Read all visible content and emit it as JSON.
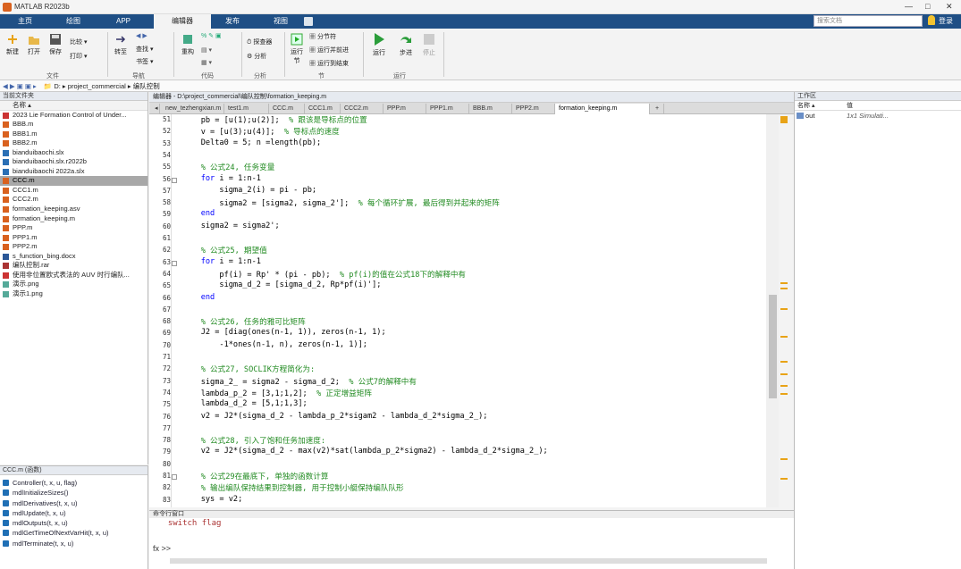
{
  "window": {
    "title": "MATLAB R2023b",
    "min": "—",
    "max": "□",
    "close": "✕"
  },
  "tabs": [
    "主页",
    "绘图",
    "APP",
    "编辑器",
    "发布",
    "视图"
  ],
  "active_tab": "编辑器",
  "search": {
    "placeholder": "搜索文档"
  },
  "user": "登录",
  "ribbon": {
    "new": "新建",
    "open": "打开",
    "save": "保存",
    "compare": "比较",
    "print": "打印",
    "file_group": "文件",
    "goto": "转至",
    "find": "查找",
    "bookmark": "书签",
    "navigate_group": "导航",
    "refactor": "重构",
    "code_group": "代码",
    "profiler": "探查器",
    "analyze": "分析",
    "analyze_group": "分析",
    "run_section": "运行节",
    "section_break": "分节符",
    "run_advance": "运行并前进",
    "run_to_end": "运行到结束",
    "section_group": "节",
    "run": "运行",
    "step": "步进",
    "stop": "停止",
    "run_group": "运行"
  },
  "address": {
    "drive": "D:",
    "folder1": "project_commercial",
    "folder2": "编队控制"
  },
  "file_panel": {
    "title": "当前文件夹",
    "col_name": "名称 ▴"
  },
  "files": [
    "2023 Lie Formation Control of Under...",
    "BBB.m",
    "BBB1.m",
    "BBB2.m",
    "bianduibaochi.slx",
    "bianduibaochi.slx.r2022b",
    "bianduibaochi 2022a.slx",
    "CCC.m",
    "CCC1.m",
    "CCC2.m",
    "formation_keeping.asv",
    "formation_keeping.m",
    "PPP.m",
    "PPP1.m",
    "PPP2.m",
    "s_function_bing.docx",
    "编队控制.rar",
    "使用非位置欧式表法的 AUV 时行编队...",
    "演示.png",
    "演示1.png"
  ],
  "selected_file": "CCC.m",
  "details": {
    "title": "CCC.m (函数)",
    "items": [
      "Controller(t, x, u, flag)",
      "mdlInitializeSizes()",
      "mdlDerivatives(t, x, u)",
      "mdlUpdate(t, x, u)",
      "mdlOutputs(t, x, u)",
      "mdlGetTimeOfNextVarHit(t, x, u)",
      "mdlTerminate(t, x, u)"
    ]
  },
  "editor": {
    "path": "编辑器 - D:\\project_commercial\\编队控制\\formation_keeping.m",
    "tabs": [
      "new_tezhengxian.m",
      "test1.m",
      "CCC.m",
      "CCC1.m",
      "CCC2.m",
      "PPP.m",
      "PPP1.m",
      "BBB.m",
      "PPP2.m",
      "formation_keeping.m"
    ],
    "active": "formation_keeping.m",
    "add": "+"
  },
  "code": [
    {
      "n": "51",
      "t": "    pb = [u(1);u(2)];  ",
      "c": "% 跟该是导标点的位置"
    },
    {
      "n": "52",
      "t": "    v = [u(3);u(4)];  ",
      "c": "% 导标点的速度"
    },
    {
      "n": "53",
      "t": "    Delta0 = 5; n =length(pb);",
      "c": ""
    },
    {
      "n": "54",
      "t": "",
      "c": ""
    },
    {
      "n": "55",
      "t": "    ",
      "c": "% 公式24, 任务变量"
    },
    {
      "n": "56",
      "t": "    ",
      "k": "for",
      "r": " i = 1:n-1",
      "f": true
    },
    {
      "n": "57",
      "t": "        sigma_2(i) = pi - pb;",
      "c": ""
    },
    {
      "n": "58",
      "t": "        sigma2 = [sigma2, sigma_2'];  ",
      "c": "% 每个循环扩展, 最后得到并起来的矩阵"
    },
    {
      "n": "59",
      "t": "    ",
      "k": "end",
      "r": ""
    },
    {
      "n": "60",
      "t": "    sigma2 = sigma2';",
      "c": ""
    },
    {
      "n": "61",
      "t": "",
      "c": ""
    },
    {
      "n": "62",
      "t": "    ",
      "c": "% 公式25, 期望值"
    },
    {
      "n": "63",
      "t": "    ",
      "k": "for",
      "r": " i = 1:n-1",
      "f": true
    },
    {
      "n": "64",
      "t": "        pf(i) = Rp' * (pi - pb);  ",
      "c": "% pf(i)的值在公式18下的解释中有"
    },
    {
      "n": "65",
      "t": "        sigma_d_2 = [sigma_d_2, Rp*pf(i)'];",
      "c": ""
    },
    {
      "n": "66",
      "t": "    ",
      "k": "end",
      "r": ""
    },
    {
      "n": "67",
      "t": "",
      "c": ""
    },
    {
      "n": "68",
      "t": "    ",
      "c": "% 公式26, 任务的雅可比矩阵"
    },
    {
      "n": "69",
      "t": "    J2 = [diag(ones(n-1, 1)), zeros(n-1, 1);",
      "c": ""
    },
    {
      "n": "70",
      "t": "        -1*ones(n-1, n), zeros(n-1, 1)];",
      "c": ""
    },
    {
      "n": "71",
      "t": "",
      "c": ""
    },
    {
      "n": "72",
      "t": "    ",
      "c": "% 公式27, SOCLIK方程简化为:"
    },
    {
      "n": "73",
      "t": "    sigma_2_ = sigma2 - sigma_d_2;  ",
      "c": "% 公式7的解释中有"
    },
    {
      "n": "74",
      "t": "    lambda_p_2 = [3,1;1,2];  ",
      "c": "% 正定增益矩阵"
    },
    {
      "n": "75",
      "t": "    lambda_d_2 = [5,1;1,3];",
      "c": ""
    },
    {
      "n": "76",
      "t": "    v2 = J2*(sigma_d_2 - lambda_p_2*sigam2 - lambda_d_2*sigma_2_);",
      "c": ""
    },
    {
      "n": "77",
      "t": "",
      "c": ""
    },
    {
      "n": "78",
      "t": "    ",
      "c": "% 公式28, 引入了饱和任务加速度:"
    },
    {
      "n": "79",
      "t": "    v2 = J2*(sigma_d_2 - max(v2)*sat(lambda_p_2*sigma2) - lambda_d_2*sigma_2_);",
      "c": ""
    },
    {
      "n": "80",
      "t": "",
      "c": ""
    },
    {
      "n": "81",
      "t": "    ",
      "c": "% 公式29在最底下, 单独的函数计算",
      "f": true
    },
    {
      "n": "82",
      "t": "    ",
      "c": "% 输出编队保持结果到控制器, 用于控制小艇保持编队队形"
    },
    {
      "n": "83",
      "t": "    sys = v2;",
      "c": ""
    }
  ],
  "command": {
    "title": "命令行窗口",
    "prev": "  switch flag",
    "prompt": "fx >>"
  },
  "workspace": {
    "title": "工作区",
    "col_name": "名称 ▴",
    "col_value": "值",
    "vars": [
      {
        "name": "out",
        "value": "1x1 Simulati..."
      }
    ]
  }
}
